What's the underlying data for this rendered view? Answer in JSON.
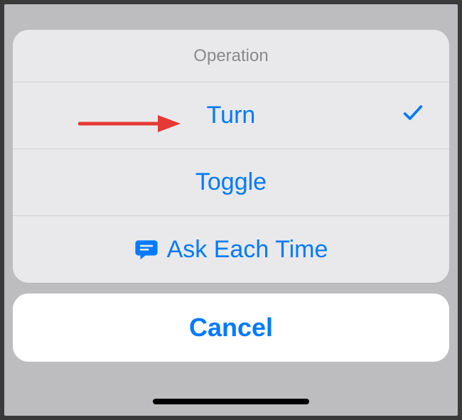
{
  "sheet": {
    "title": "Operation",
    "options": {
      "turn": {
        "label": "Turn",
        "selected": true
      },
      "toggle": {
        "label": "Toggle",
        "selected": false
      },
      "ask": {
        "label": "Ask Each Time",
        "selected": false
      }
    },
    "cancel_label": "Cancel"
  },
  "annotation": {
    "arrow_color": "#e53935"
  }
}
